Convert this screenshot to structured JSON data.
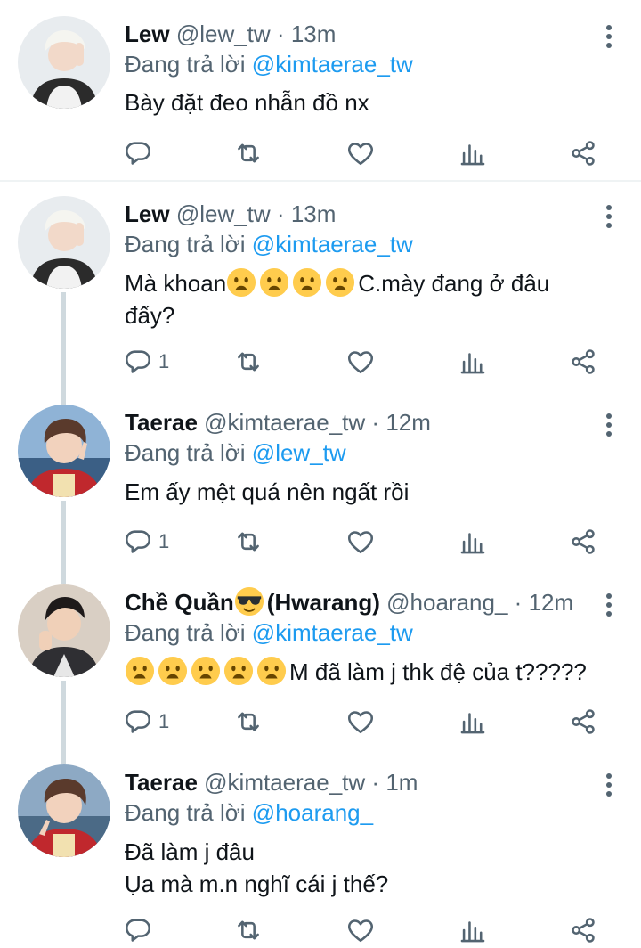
{
  "reply_prefix": "Đang trả lời",
  "tweets": [
    {
      "name": "Lew",
      "handle": "@lew_tw",
      "dot": "·",
      "time": "13m",
      "reply_to": "@kimtaerae_tw",
      "lines": [
        "Bày đặt đeo nhẫn đồ nx"
      ],
      "reply_count": ""
    },
    {
      "name": "Lew",
      "handle": "@lew_tw",
      "dot": "·",
      "time": "13m",
      "reply_to": "@kimtaerae_tw",
      "lines": [
        "Mà khoan",
        "C.mày đang ở đâu",
        "đấy?"
      ],
      "reply_count": "1"
    },
    {
      "name": "Taerae",
      "handle": "@kimtaerae_tw",
      "dot": "·",
      "time": "12m",
      "reply_to": "@lew_tw",
      "lines": [
        "Em ấy mệt quá nên ngất rồi"
      ],
      "reply_count": "1"
    },
    {
      "name": "Chề Quần",
      "name_suffix": "(Hwarang)",
      "handle": "@hoarang_",
      "dot": "·",
      "time": "12m",
      "reply_to": "@kimtaerae_tw",
      "lines": [
        "M đã làm j thk đệ của t?????"
      ],
      "reply_count": "1"
    },
    {
      "name": "Taerae",
      "handle": "@kimtaerae_tw",
      "dot": "·",
      "time": "1m",
      "reply_to": "@hoarang_",
      "lines": [
        "Đã làm j đâu",
        "Ụa mà m.n nghĩ cái j thế?"
      ],
      "reply_count": ""
    }
  ],
  "icons": {
    "reply": "reply-icon",
    "retweet": "retweet-icon",
    "like": "heart-icon",
    "stats": "analytics-icon",
    "share": "share-icon",
    "more": "more-icon",
    "emoji_frown": "frowning-face-emoji",
    "emoji_sunglasses": "sunglasses-emoji"
  },
  "colors": {
    "link": "#1d9bf0",
    "secondary": "#536471",
    "text": "#0f1419",
    "thread_line": "#cfd9de"
  }
}
